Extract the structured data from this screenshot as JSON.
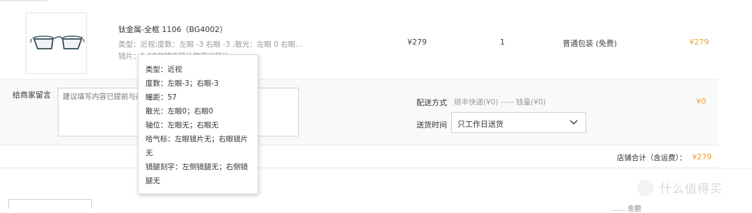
{
  "product": {
    "title": "钛金属-全框 1106（BG4002）",
    "spec": "类型：近视;度数：左眼 -3 右眼 -3 ;散光：左眼 0 右眼...",
    "lens": "镜片：1.60非球面镜片防蓝光镜片",
    "price": "¥279",
    "quantity": "1",
    "packaging": "普通包装 (免费)",
    "subtotal": "¥279"
  },
  "message": {
    "label": "给商家留言",
    "placeholder": "建议填写内容已提前与商家沟通确认"
  },
  "shipping": {
    "method_label": "配送方式",
    "method_options": "顺丰快递(¥0) ----- 钱量(¥0)",
    "fee": "¥0",
    "time_label": "送货时间",
    "time_value": "只工作日送货"
  },
  "store_total": {
    "label": "店铺合计（含运费）：",
    "value": "¥279"
  },
  "tooltip": {
    "lines": [
      "类型：近视",
      "度数：左眼-3；右眼-3",
      "瞳距：57",
      "散光：左眼0；右眼0",
      "轴位：左眼无；右眼无",
      "哈气标：左眼镜片无；右眼镜片无",
      "镜腿刻字：左侧镜腿无；右侧镜腿无"
    ]
  },
  "bottom": {
    "partial_text": "……  金额"
  },
  "watermark": {
    "text": "什么值得买"
  },
  "colors": {
    "accent_price": "#f0a030",
    "band_bg": "#f7f9fb"
  }
}
